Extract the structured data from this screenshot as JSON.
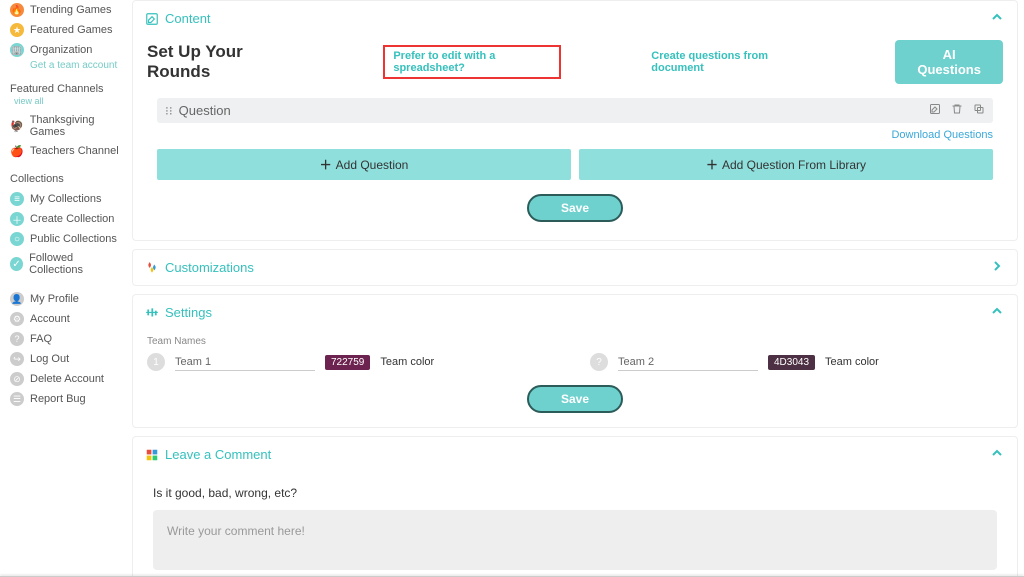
{
  "sidebar": {
    "nav": [
      {
        "id": "trending-games",
        "label": "Trending Games",
        "icon": "🔥",
        "bg": "#f58a3c"
      },
      {
        "id": "featured-games",
        "label": "Featured Games",
        "icon": "★",
        "bg": "#f5b93c"
      },
      {
        "id": "organization",
        "label": "Organization",
        "icon": "🏢",
        "bg": "#7ad6d2"
      }
    ],
    "nav_sub": "Get a team account",
    "featured_header": "Featured Channels",
    "view_all": "view all",
    "featured": [
      {
        "id": "thanksgiving",
        "label": "Thanksgiving Games",
        "icon": "🦃"
      },
      {
        "id": "teachers",
        "label": "Teachers Channel",
        "icon": "🍎"
      }
    ],
    "collections_header": "Collections",
    "collections": [
      {
        "id": "my-collections",
        "label": "My Collections",
        "bg": "#7ad6d2",
        "glyph": "≡"
      },
      {
        "id": "create-collection",
        "label": "Create Collection",
        "bg": "#7ad6d2",
        "glyph": "＋"
      },
      {
        "id": "public-collections",
        "label": "Public Collections",
        "bg": "#7ad6d2",
        "glyph": "○"
      },
      {
        "id": "followed-collections",
        "label": "Followed Collections",
        "bg": "#7ad6d2",
        "glyph": "✓"
      }
    ],
    "account": [
      {
        "id": "my-profile",
        "label": "My Profile",
        "glyph": "👤"
      },
      {
        "id": "account",
        "label": "Account",
        "glyph": "⚙"
      },
      {
        "id": "faq",
        "label": "FAQ",
        "glyph": "?"
      },
      {
        "id": "log-out",
        "label": "Log Out",
        "glyph": "↪"
      },
      {
        "id": "delete-account",
        "label": "Delete Account",
        "glyph": "⊘"
      },
      {
        "id": "report-bug",
        "label": "Report Bug",
        "glyph": "☰"
      }
    ]
  },
  "content": {
    "panel_title": "Content",
    "setup_title": "Set Up Your Rounds",
    "edit_link": "Prefer to edit with a spreadsheet?",
    "doc_link": "Create questions from document",
    "ai_btn": "AI Questions",
    "question_label": "Question",
    "download_label": "Download Questions",
    "add_question": "Add Question",
    "add_from_library": "Add Question From Library",
    "save": "Save"
  },
  "customizations": {
    "panel_title": "Customizations"
  },
  "settings": {
    "panel_title": "Settings",
    "team_names_label": "Team Names",
    "team1_badge": "1",
    "team1_value": "Team 1",
    "team1_color": "722759",
    "team2_badge": "?",
    "team2_value": "Team 2",
    "team2_color": "4D3043",
    "color_label": "Team color",
    "save": "Save"
  },
  "comment": {
    "panel_title": "Leave a Comment",
    "prompt": "Is it good, bad, wrong, etc?",
    "placeholder": "Write your comment here!"
  }
}
